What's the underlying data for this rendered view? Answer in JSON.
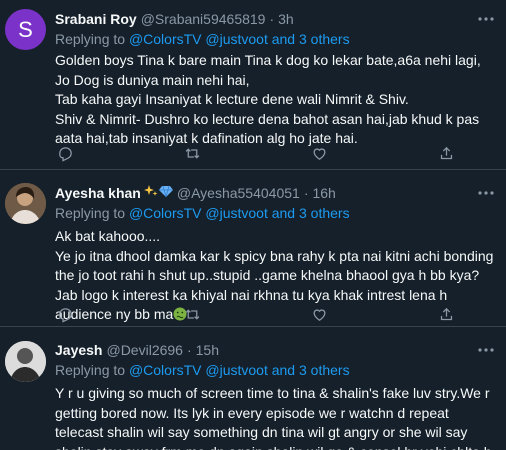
{
  "tweets": [
    {
      "name": "Srabani Roy",
      "handle": "@Srabani59465819",
      "time": "3h",
      "avatar_letter": "S",
      "replying": null,
      "text": "Golden boys Tina k bare main Tina k dog ko lekar bate,a6a nehi lagi,\nJo Dog is duniya main nehi hai,\nTab kaha gayi Insaniyat k lecture dene wali Nimrit & Shiv.\nShiv & Nimrit- Dushro ko lecture dena bahot asan hai,jab khud k pas aata hai,tab insaniyat k dafination alg ho jate hai."
    },
    {
      "name": "Ayesha khan",
      "name_emojis": [
        "sparkles-icon",
        "gem-icon"
      ],
      "handle": "@Ayesha55404051",
      "time": "16h",
      "replying_prefix": "Replying to",
      "replying_mentions": "@ColorsTV @justvoot and 3 others",
      "text": "Ak bat kahooo....\nYe jo itna dhool damka kar k spicy bna rahy k pta nai kitni achi bonding the jo toot rahi h shut up..stupid ..game khelna bhaool gya h bb kya? Jab logo k interest ka khiyal nai rkhna tu kya khak intrest lena h audience ny bb ma",
      "trailing_emoji": "nauseated-face-icon"
    },
    {
      "name": "Jayesh",
      "handle": "@Devil2696",
      "time": "15h",
      "replying_prefix": "Replying to",
      "replying_mentions": "@ColorsTV @justvoot and 3 others",
      "text": "Y r u giving so much of screen time to tina & shalin's fake luv stry.We r getting bored now. Its lyk in every episode we r watchn d repeat telecast shalin wil say something dn tina wil gt angry or she wil say shalin stay away frm me dn again shalin wil go & consol hr vohi chlta h"
    }
  ],
  "first_reply": {
    "prefix": "Replying to",
    "mentions": "@ColorsTV @justvoot and 3 others"
  },
  "separator": "·",
  "colors": {
    "background": "#15202b",
    "text": "#f7f9f9",
    "secondary": "#8b98a5",
    "link": "#1d9bf0",
    "divider": "#38444d"
  },
  "actions": [
    "reply-icon",
    "retweet-icon",
    "like-icon",
    "share-icon"
  ]
}
